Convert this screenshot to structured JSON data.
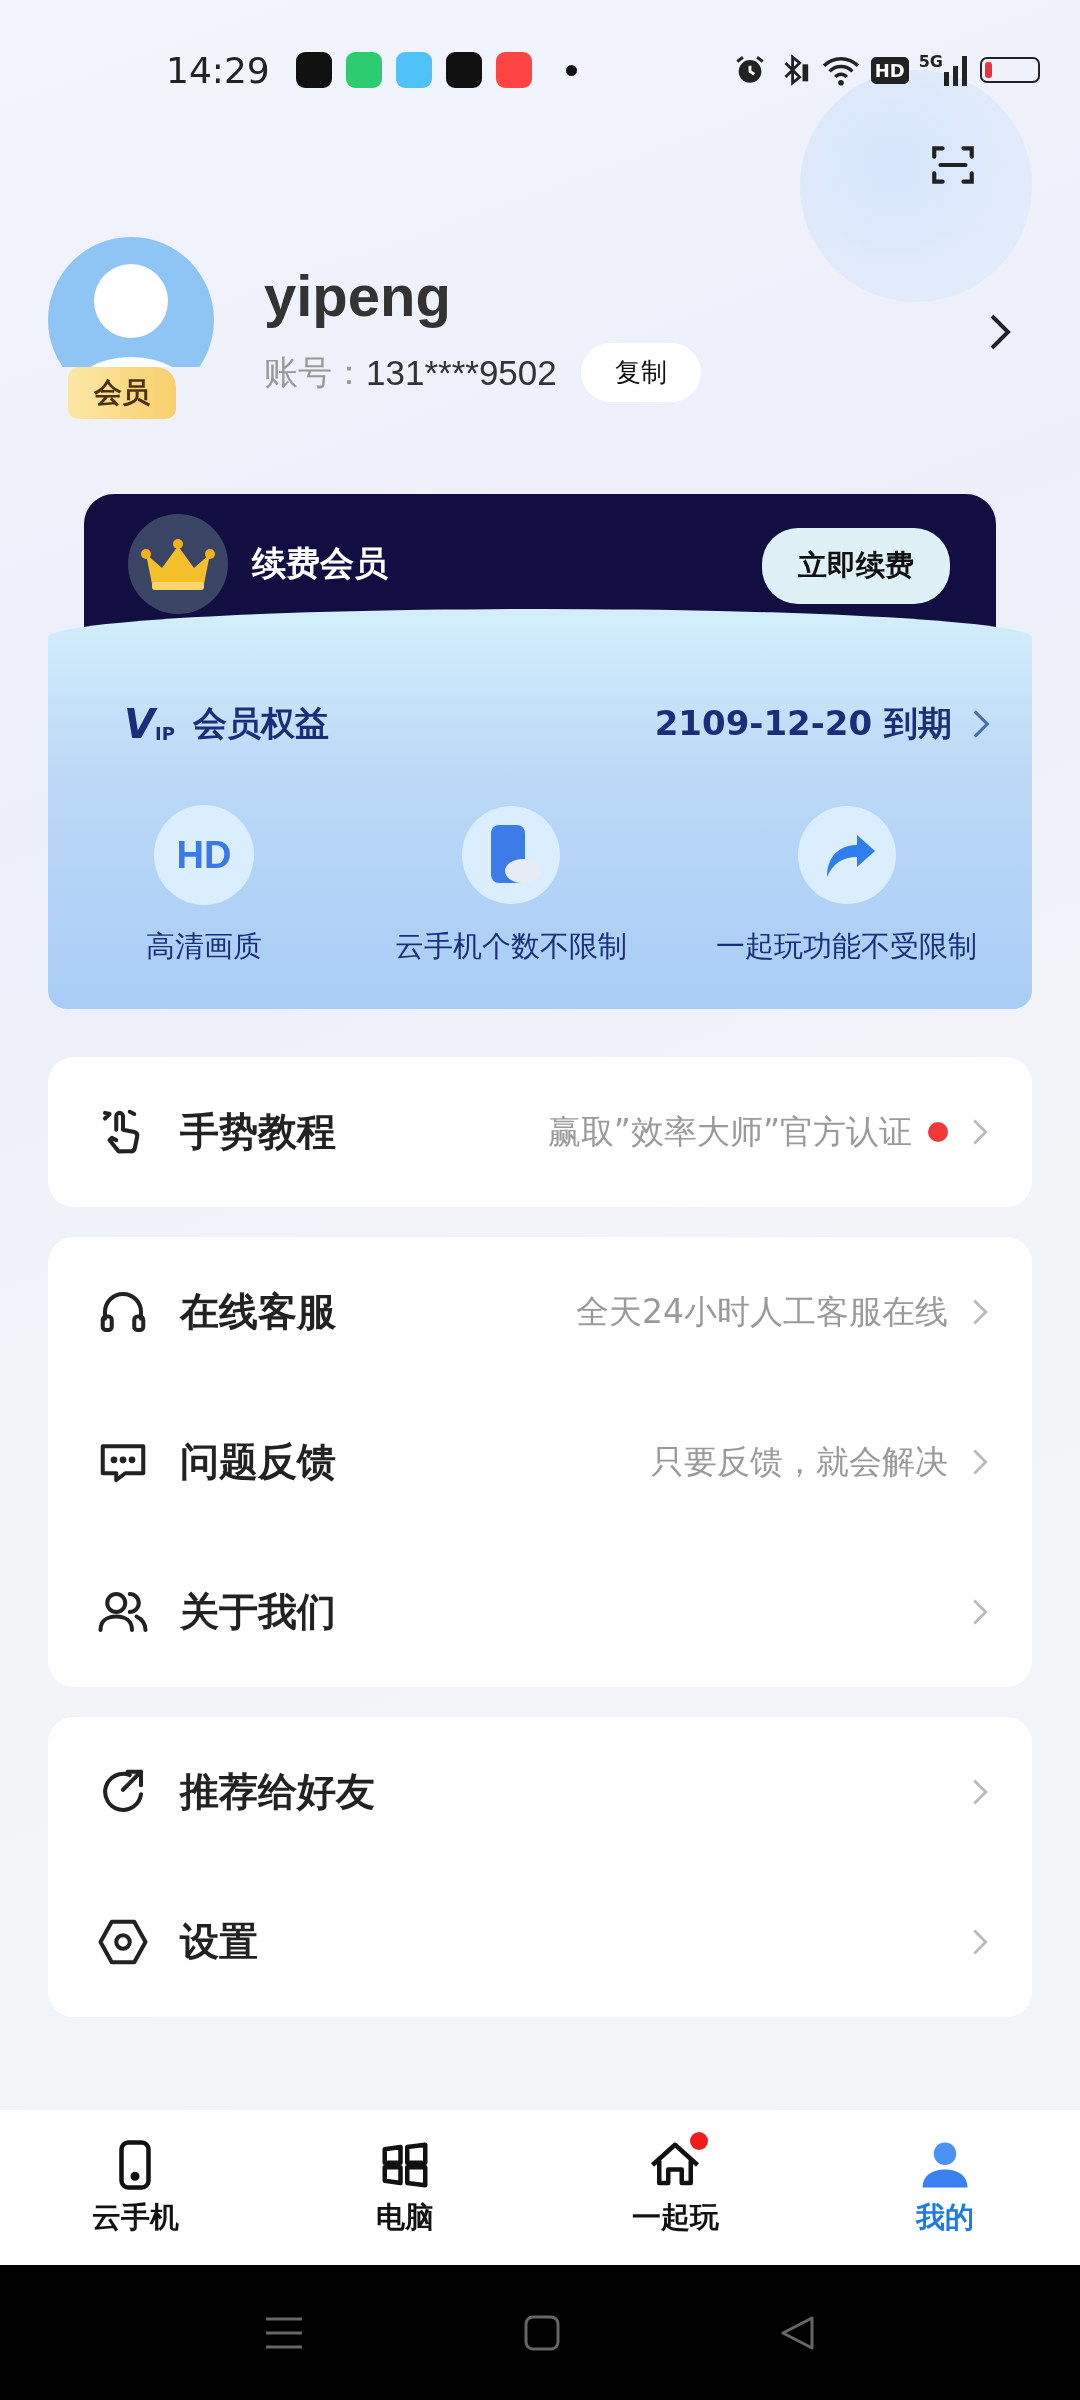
{
  "status_bar": {
    "time": "14:29",
    "hd_badge": "HD",
    "network": "5G"
  },
  "profile": {
    "name": "yipeng",
    "badge": "会员",
    "account_label": "账号：",
    "account_number": "131****9502",
    "copy_button": "复制"
  },
  "vip": {
    "title": "续费会员",
    "renew_button": "立即续费",
    "logo_main": "V",
    "logo_sub": "IP",
    "benefits_title": "会员权益",
    "expiry": "2109-12-20 到期",
    "benefits": [
      {
        "kind": "hd",
        "icon_text": "HD",
        "label": "高清画质"
      },
      {
        "kind": "phone",
        "label": "云手机个数不限制"
      },
      {
        "kind": "share",
        "label": "一起玩功能不受限制"
      }
    ]
  },
  "menu_groups": [
    {
      "items": [
        {
          "kind": "gesture",
          "label": "手势教程",
          "hint": "赢取”效率大师”官方认证",
          "dot": true
        }
      ]
    },
    {
      "items": [
        {
          "kind": "headset",
          "label": "在线客服",
          "hint": "全天24小时人工客服在线",
          "dot": false
        },
        {
          "kind": "message",
          "label": "问题反馈",
          "hint": "只要反馈，就会解决",
          "dot": false
        },
        {
          "kind": "people",
          "label": "关于我们",
          "dot": false
        }
      ]
    },
    {
      "items": [
        {
          "kind": "share",
          "label": "推荐给好友",
          "dot": false
        },
        {
          "kind": "settings",
          "label": "设置",
          "dot": false
        }
      ]
    }
  ],
  "bottom_nav": [
    {
      "kind": "phone",
      "label": "云手机",
      "selected": false,
      "dot": false
    },
    {
      "kind": "windows",
      "label": "电脑",
      "selected": false,
      "dot": false
    },
    {
      "kind": "home",
      "label": "一起玩",
      "selected": false,
      "dot": true
    },
    {
      "kind": "person",
      "label": "我的",
      "selected": true,
      "dot": false
    }
  ]
}
